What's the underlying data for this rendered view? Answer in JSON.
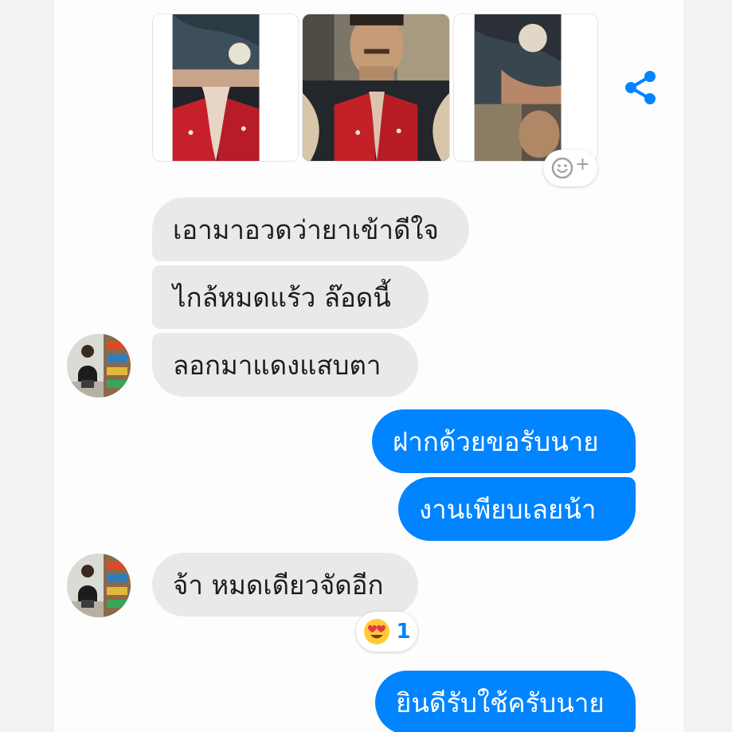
{
  "conversation": {
    "incoming": [
      {
        "text": "เอามาอวดว่ายาเข้าดีใจ"
      },
      {
        "text": "ไกล้หมดแร้ว ล๊อดนี้"
      },
      {
        "text": "ลอกมาแดงแสบตา"
      },
      {
        "text": "จ้า หมดเดียวจัดอีก"
      }
    ],
    "outgoing": [
      {
        "text": "ฝากด้วยขอรับนาย"
      },
      {
        "text": "งานเพียบเลยน้า"
      },
      {
        "text": "ยินดีรับใช้ครับนาย"
      }
    ],
    "reaction": {
      "emoji": "heart-eyes-emoji-icon",
      "count": "1"
    }
  },
  "colors": {
    "outgoing_bubble": "#0084ff",
    "incoming_bubble": "#e9e9e9",
    "accent": "#0084ff",
    "background": "#fdfdfd"
  },
  "icons": {
    "share": "share-icon",
    "add_reaction": "add-reaction-icon"
  }
}
